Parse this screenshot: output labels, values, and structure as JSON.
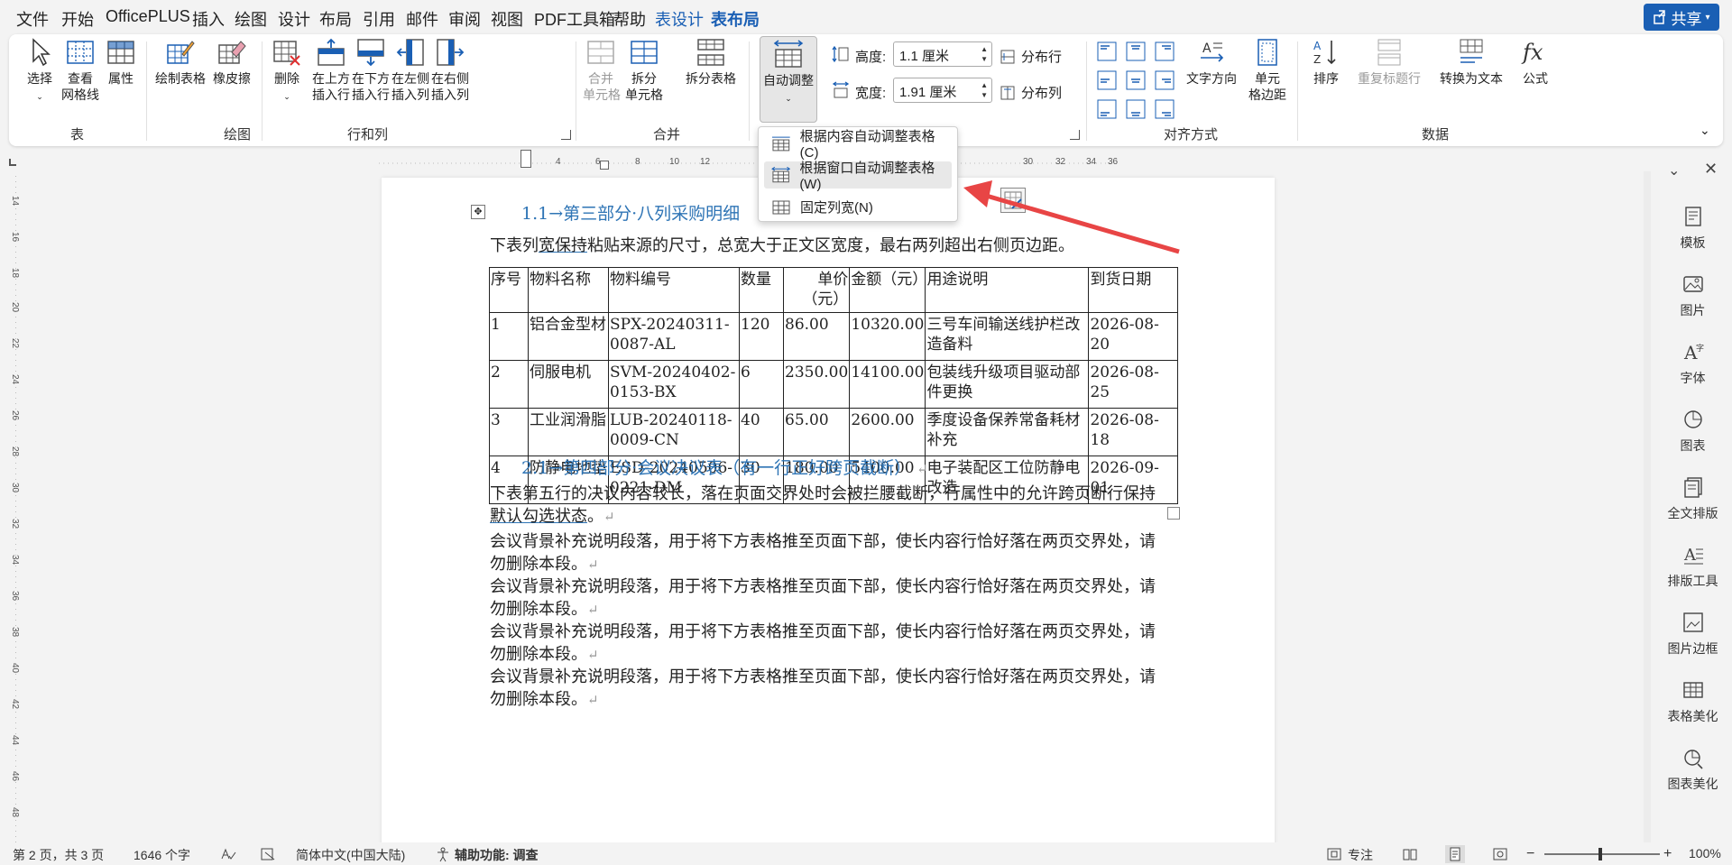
{
  "menubar": {
    "items": [
      "文件",
      "开始",
      "OfficePLUS",
      "插入",
      "绘图",
      "设计",
      "布局",
      "引用",
      "邮件",
      "审阅",
      "视图",
      "PDF工具箱",
      "帮助",
      "表设计",
      "表布局"
    ],
    "share": "共享"
  },
  "ribbon": {
    "groups": {
      "table": {
        "label": "表",
        "select": "选择",
        "gridlines": "查看\n网格线",
        "properties": "属性"
      },
      "draw": {
        "label": "绘图",
        "draw_table": "绘制表格",
        "eraser": "橡皮擦"
      },
      "rows_cols": {
        "label": "行和列",
        "delete": "删除",
        "insert_above": "在上方\n插入行",
        "insert_below": "在下方\n插入行",
        "insert_left": "在左侧\n插入列",
        "insert_right": "在右侧\n插入列"
      },
      "merge": {
        "label": "合并",
        "merge_cells": "合并\n单元格",
        "split_cells": "拆分\n单元格",
        "split_table": "拆分表格"
      },
      "cell_size": {
        "autofit": "自动调整",
        "height_label": "高度:",
        "height_value": "1.1 厘米",
        "width_label": "宽度:",
        "width_value": "1.91 厘米",
        "distribute_rows": "分布行",
        "distribute_cols": "分布列"
      },
      "alignment": {
        "label": "对齐方式",
        "text_direction": "文字方向",
        "cell_margins": "单元\n格边距"
      },
      "data": {
        "label": "数据",
        "sort": "排序",
        "repeat_header": "重复标题行",
        "convert_text": "转换为文本",
        "formula": "公式"
      }
    }
  },
  "dropdown": {
    "items": [
      "根据内容自动调整表格(C)",
      "根据窗口自动调整表格(W)",
      "固定列宽(N)"
    ]
  },
  "ruler": {
    "h_ticks": [
      "4",
      "6",
      "8",
      "10",
      "12",
      "30",
      "32",
      "34",
      "36"
    ],
    "v_ticks": [
      "14",
      "16",
      "18",
      "20",
      "22",
      "24",
      "26",
      "28",
      "30",
      "32",
      "34",
      "36",
      "38",
      "40",
      "42",
      "44",
      "46",
      "48"
    ]
  },
  "document": {
    "heading1": "1.1→第三部分·八列采购明细",
    "para1_pre": "下表列",
    "para1_ul": "宽保持",
    "para1_post": "粘贴来源的尺寸，总宽大于正文区宽度，最右两列超出右侧页边距。",
    "table": {
      "headers": [
        "序号",
        "物料名称",
        "物料编号",
        "数量",
        "单价（元）",
        "金额（元）",
        "用途说明",
        "到货日期"
      ],
      "rows": [
        [
          "1",
          "铝合金型材",
          "SPX-20240311-0087-AL",
          "120",
          "86.00",
          "10320.00",
          "三号车间输送线护栏改造备料",
          "2026-08-20"
        ],
        [
          "2",
          "伺服电机",
          "SVM-20240402-0153-BX",
          "6",
          "2350.00",
          "14100.00",
          "包装线升级项目驱动部件更换",
          "2026-08-25"
        ],
        [
          "3",
          "工业润滑脂",
          "LUB-20240118-0009-CN",
          "40",
          "65.00",
          "2600.00",
          "季度设备保养常备耗材补充",
          "2026-08-18"
        ],
        [
          "4",
          "防静电地垫",
          "ESD-20240506-0221-DM",
          "30",
          "180.00",
          "5400.00",
          "电子装配区工位防静电改造",
          "2026-09-01"
        ]
      ]
    },
    "heading2": "2.1→第四部分·会议决议表（有一行正好跨页截断）",
    "para2_pre": "下表第五行的决议内容较长，落在页面交界处时会被拦腰截断，行属性中的允许跨页断行保持",
    "para2_ul": "默认勾选状态",
    "para2_post": "。",
    "filler": "会议背景补充说明段落，用于将下方表格推至页面下部，使长内容行恰好落在两页交界处，请勿删除本段。"
  },
  "right_panel": {
    "items": [
      "模板",
      "图片",
      "字体",
      "图表",
      "全文排版",
      "排版工具",
      "图片边框",
      "表格美化",
      "图表美化"
    ]
  },
  "statusbar": {
    "page": "第 2 页，共 3 页",
    "words": "1646 个字",
    "language": "简体中文(中国大陆)",
    "accessibility": "辅助功能: 调查",
    "focus": "专注",
    "zoom": "100%"
  },
  "colors": {
    "accent": "#1a5fb4",
    "heading": "#2e74b5",
    "arrow": "#e84545"
  }
}
